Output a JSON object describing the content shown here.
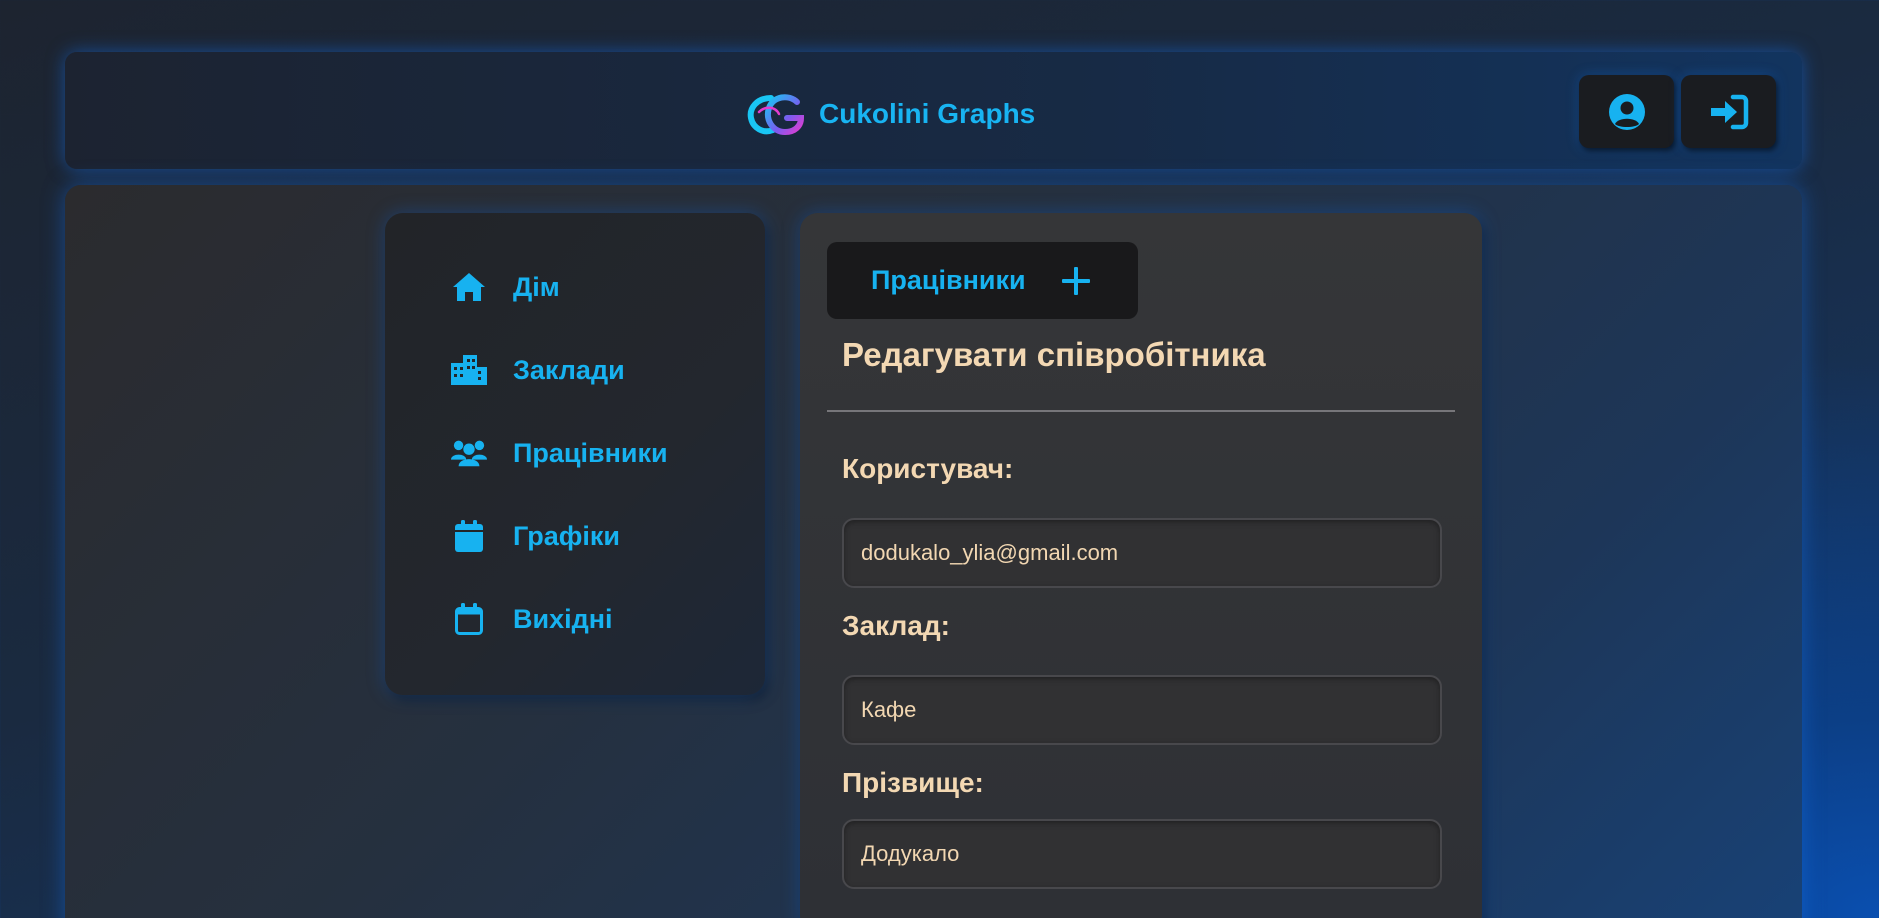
{
  "header": {
    "brand": "Cukolini Graphs",
    "profile_icon": "user-circle-icon",
    "login_icon": "sign-in-icon"
  },
  "colors": {
    "accent": "#17b2f0",
    "label": "#f3d8b3",
    "panel": "#353638"
  },
  "sidebar": {
    "items": [
      {
        "label": "Дім",
        "icon": "home-icon"
      },
      {
        "label": "Заклади",
        "icon": "buildings-icon"
      },
      {
        "label": "Працівники",
        "icon": "users-icon"
      },
      {
        "label": "Графіки",
        "icon": "calendar-filled-icon"
      },
      {
        "label": "Вихідні",
        "icon": "calendar-outline-icon"
      }
    ]
  },
  "panel": {
    "tab_label": "Працівники",
    "tab_icon": "plus-icon",
    "title": "Редагувати співробітника",
    "fields": [
      {
        "label": "Користувач:",
        "value": "dodukalo_ylia@gmail.com"
      },
      {
        "label": "Заклад:",
        "value": "Кафе"
      },
      {
        "label": "Прізвище:",
        "value": "Додукало"
      }
    ]
  }
}
